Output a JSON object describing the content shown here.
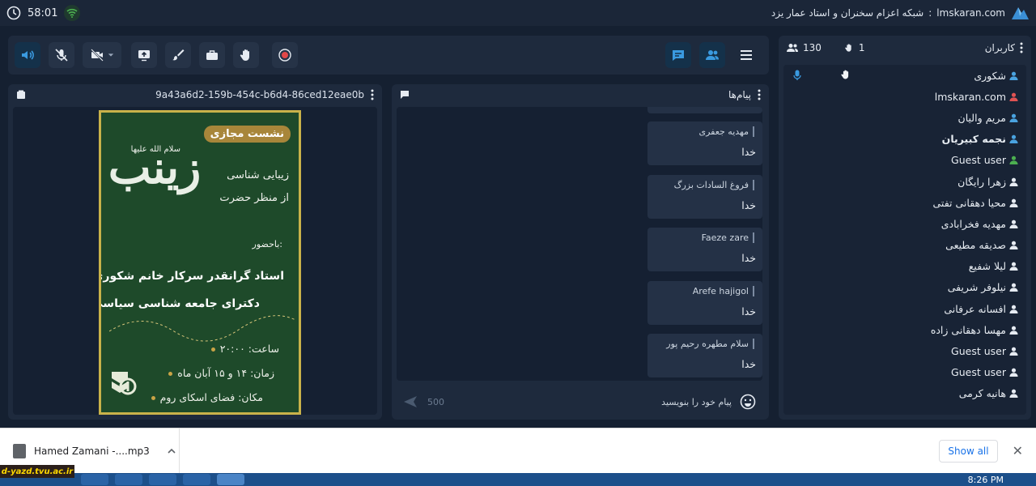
{
  "header": {
    "timer": "58:01",
    "site": "lmskaran.com",
    "separator": ":",
    "title": "شبکه اعزام سخنران و استاد عمار یزد"
  },
  "colors": {
    "accent": "#3a8fd6",
    "background": "#152031",
    "panel": "#1e2a3d",
    "user_icon": "#4aa3e0"
  },
  "users_panel": {
    "title": "کاربران",
    "hand_count": "1",
    "user_count": "130",
    "users": [
      {
        "name": "شکوری",
        "bold": false,
        "icon_color": "#4aa3e0"
      },
      {
        "name": "lmskaran.com",
        "bold": false,
        "icon_color": "#e05353"
      },
      {
        "name": "مریم والیان",
        "bold": false,
        "icon_color": "#4aa3e0"
      },
      {
        "name": "نجمه کبیریان",
        "bold": true,
        "icon_color": "#4aa3e0"
      },
      {
        "name": "Guest user",
        "bold": false,
        "icon_color": "#4caf50"
      },
      {
        "name": "زهرا رایگان",
        "bold": false,
        "icon_color": "#e6ebf2"
      },
      {
        "name": "محیا دهقانی تفتی",
        "bold": false,
        "icon_color": "#e6ebf2"
      },
      {
        "name": "مهدیه فخرابادی",
        "bold": false,
        "icon_color": "#e6ebf2"
      },
      {
        "name": "صدیقه مطیعی",
        "bold": false,
        "icon_color": "#e6ebf2"
      },
      {
        "name": "لیلا شفیع",
        "bold": false,
        "icon_color": "#e6ebf2"
      },
      {
        "name": "نیلوفر شریفی",
        "bold": false,
        "icon_color": "#e6ebf2"
      },
      {
        "name": "افسانه عرفانی",
        "bold": false,
        "icon_color": "#e6ebf2"
      },
      {
        "name": "مهسا دهقانی زاده",
        "bold": false,
        "icon_color": "#e6ebf2"
      },
      {
        "name": "Guest user",
        "bold": false,
        "icon_color": "#e6ebf2"
      },
      {
        "name": "Guest user",
        "bold": false,
        "icon_color": "#e6ebf2"
      },
      {
        "name": "هانیه کرمی",
        "bold": false,
        "icon_color": "#e6ebf2"
      }
    ]
  },
  "content_panel": {
    "id": "9a43a6d2-159b-454c-b6d4-86ced12eae0b"
  },
  "poster": {
    "badge": "نشست مجازی",
    "name": "زینب",
    "salam": "سلام الله علیها",
    "line1": "زیبایی شناسی",
    "line2": "از منظر حضرت",
    "with": "باحضور:",
    "speaker": "استاد گرانقدر سرکار خانم شکوری",
    "degree": "دکترای جامعه شناسی سیاسی",
    "time": "ساعت: ۲۰:۰۰",
    "date": "زمان: ۱۴ و ۱۵ آبان ماه",
    "place": "مکان: فضای اسکای روم"
  },
  "chat_panel": {
    "title": "پیام‌ها",
    "messages": [
      {
        "sender": "مهدیه جعفری",
        "text": "خدا"
      },
      {
        "sender": "فروغ السادات بزرگ",
        "text": "خدا"
      },
      {
        "sender": "Faeze zare",
        "text": "خدا"
      },
      {
        "sender": "Arefe hajigol",
        "text": "خدا"
      },
      {
        "sender": "سلام مطهره رحیم پور",
        "text": "خدا"
      }
    ],
    "char_limit": "500",
    "placeholder": "پیام خود را بنویسید"
  },
  "download_bar": {
    "file_name": "Hamed Zamani -....mp3",
    "show_all": "Show all"
  },
  "watermark": "d-yazd.tvu.ac.ir",
  "taskbar": {
    "clock": "8:26 PM"
  }
}
